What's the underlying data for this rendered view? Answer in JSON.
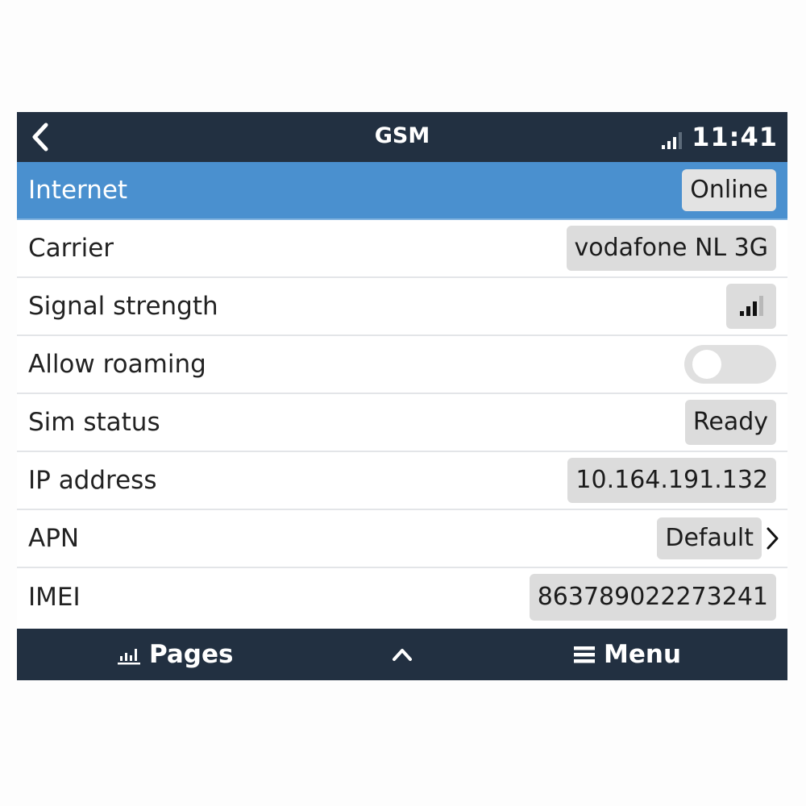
{
  "header": {
    "title": "GSM",
    "time": "11:41",
    "back_icon": "chevron-left-icon",
    "signal_icon": "signal-bars-icon",
    "signal_level": "3 of 4 bars"
  },
  "rows": [
    {
      "label": "Internet",
      "value": "Online",
      "selected": true
    },
    {
      "label": "Carrier",
      "value": "vodafone NL 3G"
    },
    {
      "label": "Signal strength",
      "value_icon": "signal-bars-icon",
      "signal_level": "3 of 4 bars"
    },
    {
      "label": "Allow roaming",
      "toggle": "off"
    },
    {
      "label": "Sim status",
      "value": "Ready"
    },
    {
      "label": "IP address",
      "value": "10.164.191.132"
    },
    {
      "label": "APN",
      "value": "Default",
      "has_chevron": true
    },
    {
      "label": "IMEI",
      "value": "863789022273241"
    }
  ],
  "footer": {
    "pages_label": "Pages",
    "pages_icon": "bar-chart-icon",
    "up_icon": "chevron-up-icon",
    "menu_label": "Menu",
    "menu_icon": "hamburger-icon"
  },
  "colors": {
    "header_bg": "#223041",
    "selected_row": "#4a90cf",
    "value_bg": "#dcdcdc"
  }
}
